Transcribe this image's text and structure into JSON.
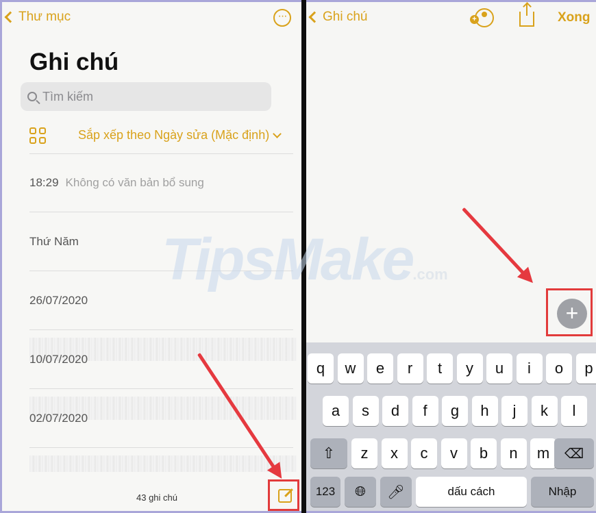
{
  "left_pane": {
    "back_label": "Thư mục",
    "more_label": "···",
    "title": "Ghi chú",
    "search_placeholder": "Tìm kiếm",
    "sort_label": "Sắp xếp theo Ngày sửa (Mặc định)",
    "notes": [
      {
        "time": "18:29",
        "subtitle": "Không có văn bản bổ sung"
      },
      {
        "label": "Thứ Năm"
      },
      {
        "label": "26/07/2020"
      },
      {
        "label": "10/07/2020"
      },
      {
        "label": "02/07/2020"
      }
    ],
    "note_count": "43 ghi chú"
  },
  "right_pane": {
    "back_label": "Ghi chú",
    "done_label": "Xong",
    "plus_label": "+"
  },
  "keyboard": {
    "row1": [
      "q",
      "w",
      "e",
      "r",
      "t",
      "y",
      "u",
      "i",
      "o",
      "p"
    ],
    "row2": [
      "a",
      "s",
      "d",
      "f",
      "g",
      "h",
      "j",
      "k",
      "l"
    ],
    "row3": [
      "z",
      "x",
      "c",
      "v",
      "b",
      "n",
      "m"
    ],
    "numbers_label": "123",
    "space_label": "dấu cách",
    "return_label": "Nhập"
  },
  "watermark": {
    "brand": "TipsMake",
    "suffix": ".com"
  },
  "colors": {
    "accent": "#d9a21b",
    "highlight": "#e23b3b",
    "arrow": "#e5393f"
  }
}
